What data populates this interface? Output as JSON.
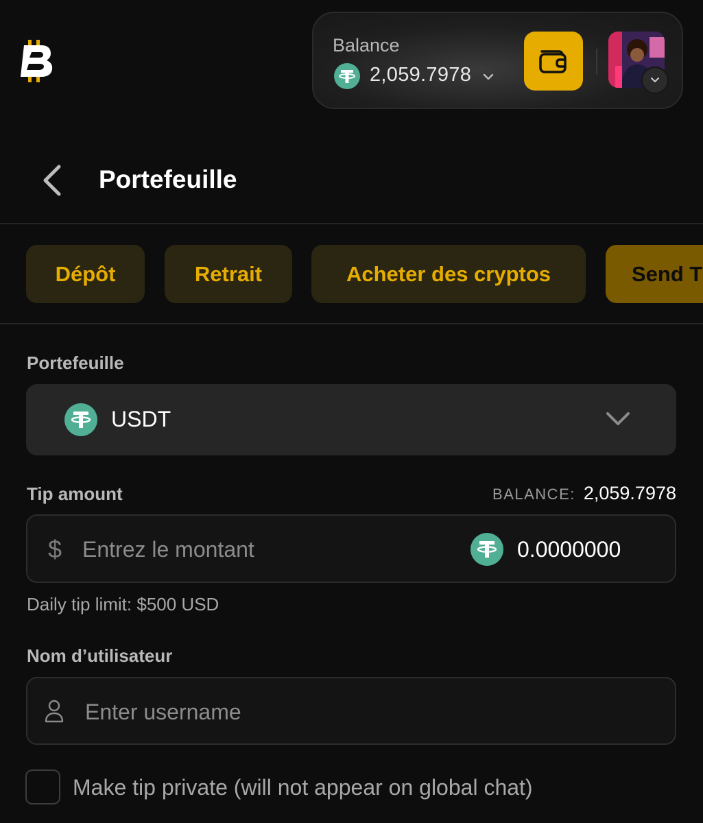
{
  "header": {
    "logo_icon": "bitcoin-b-logo-icon",
    "balance_label": "Balance",
    "balance_value": "2,059.7978",
    "balance_coin_icon": "tether-usdt-icon",
    "wallet_icon": "wallet-icon",
    "accent": "#e6ad00"
  },
  "page": {
    "title": "Portefeuille",
    "back_icon": "chevron-left-icon"
  },
  "tabs": [
    {
      "label": "Dépôt"
    },
    {
      "label": "Retrait"
    },
    {
      "label": "Acheter des cryptos"
    },
    {
      "label": "Send T",
      "active": true
    }
  ],
  "form": {
    "wallet_label": "Portefeuille",
    "wallet_selected": "USDT",
    "tip_amount_label": "Tip amount",
    "balance_inline_label": "BALANCE:",
    "balance_inline_value": "2,059.7978",
    "currency_symbol": "$",
    "amount_placeholder": "Entrez le montant",
    "crypto_amount": "0.0000000",
    "daily_limit": "Daily tip limit: $500 USD",
    "username_label": "Nom d’utilisateur",
    "username_placeholder": "Enter username",
    "private_checkbox_label": "Make tip private (will not appear on global chat)",
    "private_checked": false
  },
  "colors": {
    "background": "#0d0d0d",
    "tether_green": "#50af95",
    "tab_bg": "#2b2612",
    "tab_active_bg": "#7a5a00"
  }
}
